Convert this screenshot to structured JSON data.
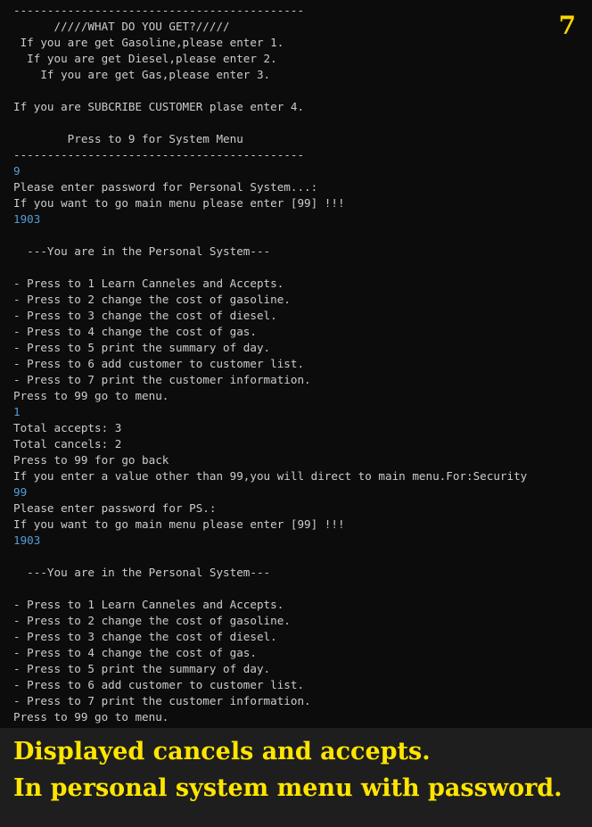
{
  "slide_number": "7",
  "console": {
    "lines": [
      {
        "text": "-------------------------------------------",
        "kind": "output"
      },
      {
        "text": "      /////WHAT DO YOU GET?/////",
        "kind": "output"
      },
      {
        "text": " If you are get Gasoline,please enter 1.",
        "kind": "output"
      },
      {
        "text": "  If you are get Diesel,please enter 2.",
        "kind": "output"
      },
      {
        "text": "    If you are get Gas,please enter 3.",
        "kind": "output"
      },
      {
        "text": "",
        "kind": "output"
      },
      {
        "text": "If you are SUBCRIBE CUSTOMER plase enter 4.",
        "kind": "output"
      },
      {
        "text": "",
        "kind": "output"
      },
      {
        "text": "        Press to 9 for System Menu",
        "kind": "output"
      },
      {
        "text": "-------------------------------------------",
        "kind": "output"
      },
      {
        "text": "9",
        "kind": "input"
      },
      {
        "text": "Please enter password for Personal System...:",
        "kind": "output"
      },
      {
        "text": "If you want to go main menu please enter [99] !!!",
        "kind": "output"
      },
      {
        "text": "1903",
        "kind": "input"
      },
      {
        "text": "",
        "kind": "output"
      },
      {
        "text": "  ---You are in the Personal System---",
        "kind": "output"
      },
      {
        "text": "",
        "kind": "output"
      },
      {
        "text": "- Press to 1 Learn Canneles and Accepts.",
        "kind": "output"
      },
      {
        "text": "- Press to 2 change the cost of gasoline.",
        "kind": "output"
      },
      {
        "text": "- Press to 3 change the cost of diesel.",
        "kind": "output"
      },
      {
        "text": "- Press to 4 change the cost of gas.",
        "kind": "output"
      },
      {
        "text": "- Press to 5 print the summary of day.",
        "kind": "output"
      },
      {
        "text": "- Press to 6 add customer to customer list.",
        "kind": "output"
      },
      {
        "text": "- Press to 7 print the customer information.",
        "kind": "output"
      },
      {
        "text": "Press to 99 go to menu.",
        "kind": "output"
      },
      {
        "text": "1",
        "kind": "input"
      },
      {
        "text": "Total accepts: 3",
        "kind": "output"
      },
      {
        "text": "Total cancels: 2",
        "kind": "output"
      },
      {
        "text": "Press to 99 for go back",
        "kind": "output"
      },
      {
        "text": "If you enter a value other than 99,you will direct to main menu.For:Security",
        "kind": "output"
      },
      {
        "text": "99",
        "kind": "input"
      },
      {
        "text": "Please enter password for PS.:",
        "kind": "output"
      },
      {
        "text": "If you want to go main menu please enter [99] !!!",
        "kind": "output"
      },
      {
        "text": "1903",
        "kind": "input"
      },
      {
        "text": "",
        "kind": "output"
      },
      {
        "text": "  ---You are in the Personal System---",
        "kind": "output"
      },
      {
        "text": "",
        "kind": "output"
      },
      {
        "text": "- Press to 1 Learn Canneles and Accepts.",
        "kind": "output"
      },
      {
        "text": "- Press to 2 change the cost of gasoline.",
        "kind": "output"
      },
      {
        "text": "- Press to 3 change the cost of diesel.",
        "kind": "output"
      },
      {
        "text": "- Press to 4 change the cost of gas.",
        "kind": "output"
      },
      {
        "text": "- Press to 5 print the summary of day.",
        "kind": "output"
      },
      {
        "text": "- Press to 6 add customer to customer list.",
        "kind": "output"
      },
      {
        "text": "- Press to 7 print the customer information.",
        "kind": "output"
      },
      {
        "text": "Press to 99 go to menu.",
        "kind": "output"
      }
    ]
  },
  "caption": {
    "line1": "Displayed cancels and accepts.",
    "line2": "In personal  system menu with password."
  },
  "colors": {
    "console_background": "#0c0c0c",
    "console_text": "#cccccc",
    "user_input_text": "#569cd6",
    "caption_text": "#ffe500",
    "slide_number_text": "#ffd700",
    "slide_background": "#1e1e1e"
  }
}
